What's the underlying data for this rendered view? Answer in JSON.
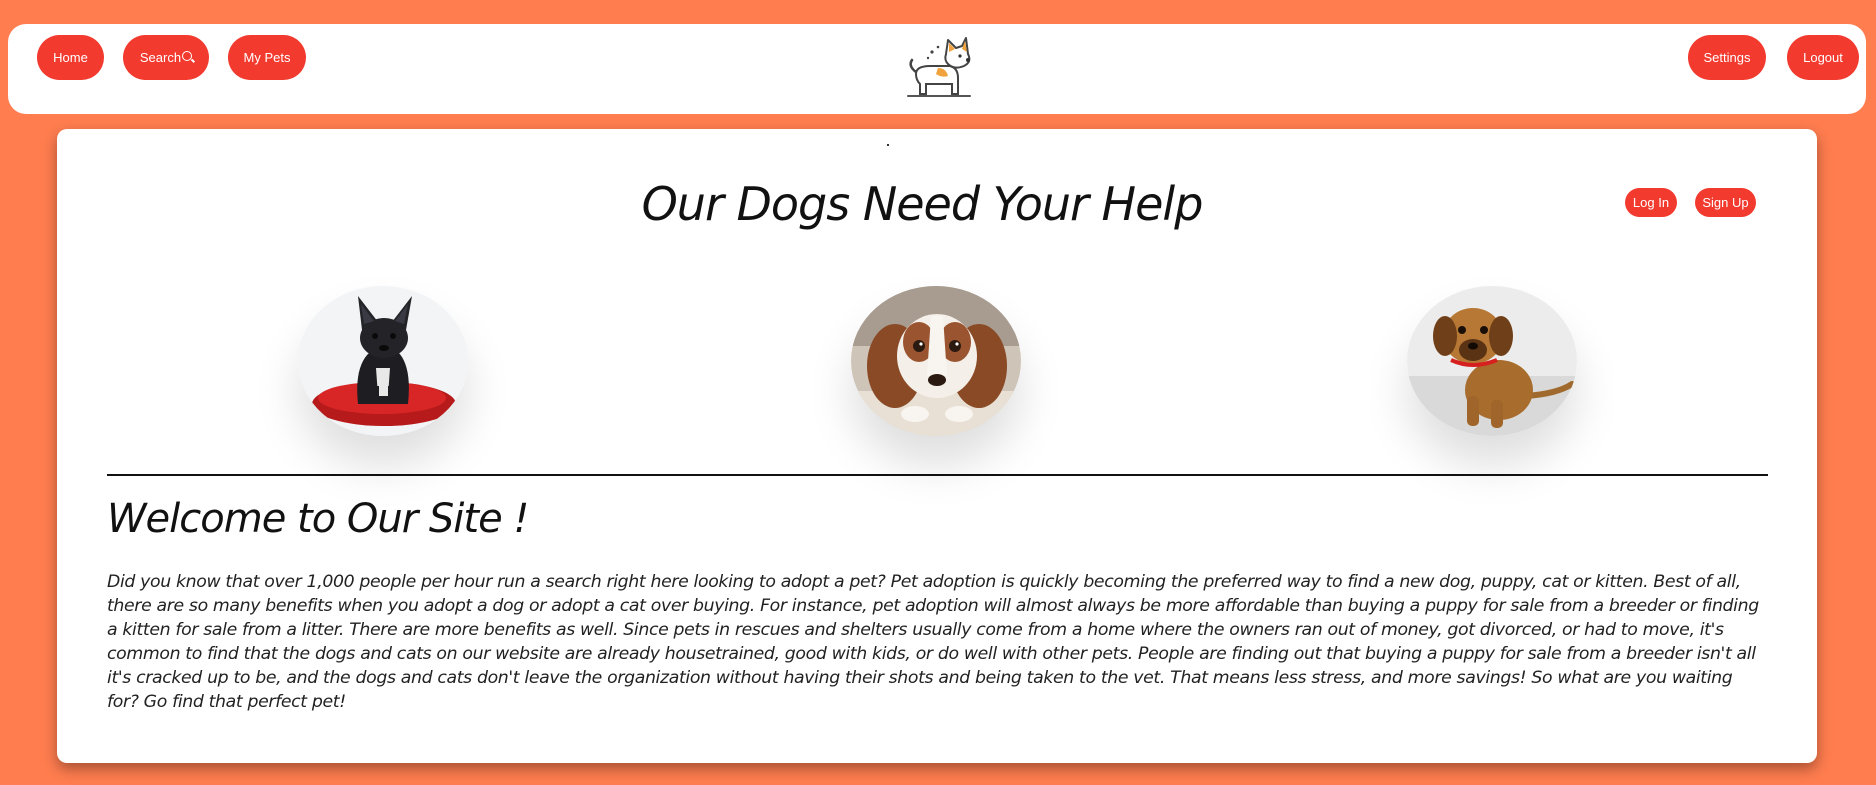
{
  "nav": {
    "home_label": "Home",
    "search_label": "Search",
    "mypets_label": "My Pets",
    "settings_label": "Settings",
    "logout_label": "Logout"
  },
  "header": {
    "logo_icon": "dog-logo-icon"
  },
  "main": {
    "title": "Our Dogs Need Your Help",
    "login_label": "Log In",
    "signup_label": "Sign Up",
    "dogs": [
      {
        "icon": "french-bulldog-photo"
      },
      {
        "icon": "spaniel-photo"
      },
      {
        "icon": "brown-puppy-photo"
      }
    ],
    "welcome_heading": "Welcome to Our Site !",
    "intro_text": "Did you know that over 1,000 people per hour run a search right here looking to adopt a pet? Pet adoption is quickly becoming the preferred way to find a new dog, puppy, cat or kitten. Best of all, there are so many benefits when you adopt a dog or adopt a cat over buying. For instance, pet adoption will almost always be more affordable than buying a puppy for sale from a breeder or finding a kitten for sale from a litter. There are more benefits as well. Since pets in rescues and shelters usually come from a home where the owners ran out of money, got divorced, or had to move, it's common to find that the dogs and cats on our website are already housetrained, good with kids, or do well with other pets. People are finding out that buying a puppy for sale from a breeder isn't all it's cracked up to be, and the dogs and cats don't leave the organization without having their shots and being taken to the vet. That means less stress, and more savings! So what are you waiting for? Go find that perfect pet!"
  },
  "colors": {
    "page_background": "#ff7d4f",
    "button": "#f23a2f",
    "card": "#ffffff"
  }
}
